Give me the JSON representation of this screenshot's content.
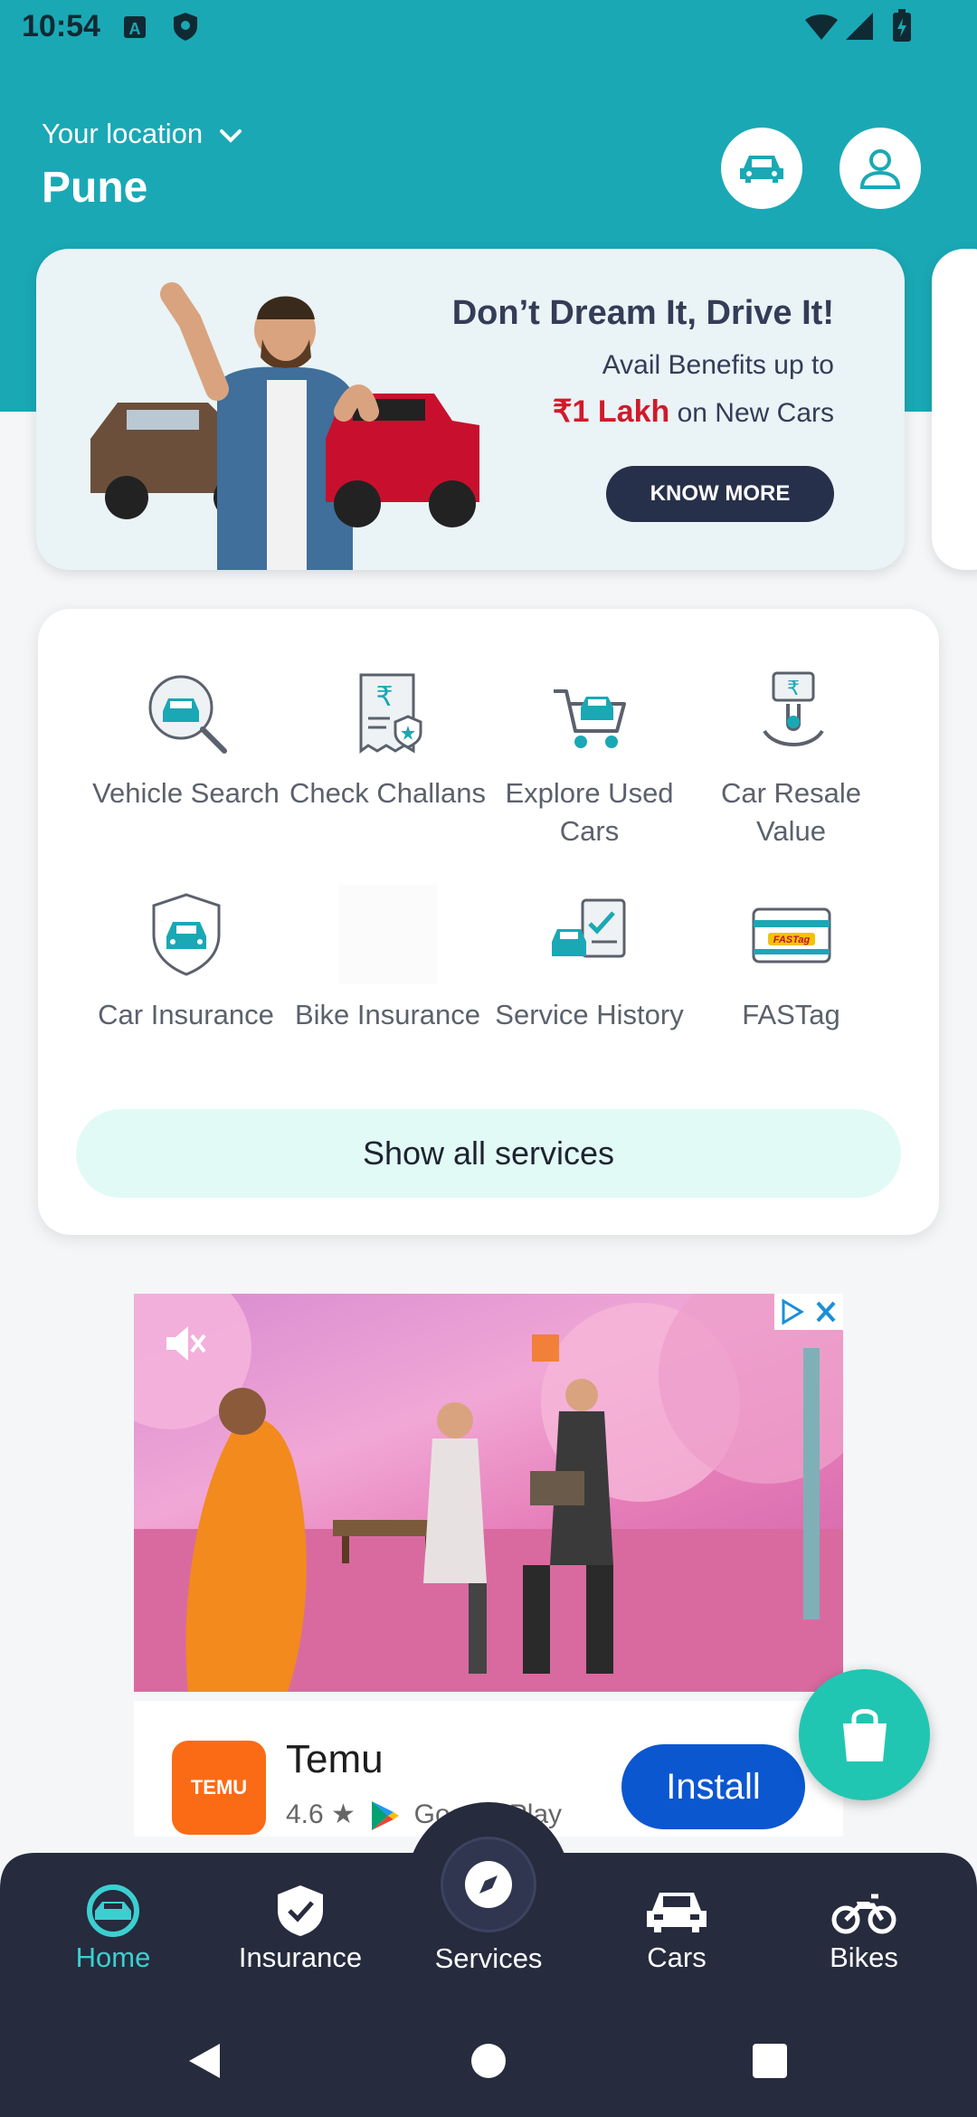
{
  "status_bar": {
    "time": "10:54"
  },
  "header": {
    "location_label": "Your location",
    "city": "Pune"
  },
  "banner": {
    "headline": "Don’t Dream It, Drive It!",
    "line1": "Avail Benefits up to",
    "highlight": "₹1 Lakh",
    "line2_suffix": " on New Cars",
    "cta": "KNOW MORE"
  },
  "services": {
    "items": [
      {
        "label": "Vehicle Search",
        "icon": "vehicle-search-icon"
      },
      {
        "label": "Check Challans",
        "icon": "challan-icon"
      },
      {
        "label": "Explore Used Cars",
        "icon": "used-cars-icon"
      },
      {
        "label": "Car Resale Value",
        "icon": "resale-value-icon"
      },
      {
        "label": "Car Insurance",
        "icon": "car-insurance-icon"
      },
      {
        "label": "Bike Insurance",
        "icon": "bike-insurance-icon"
      },
      {
        "label": "Service History",
        "icon": "service-history-icon"
      },
      {
        "label": "FASTag",
        "icon": "fastag-icon"
      }
    ],
    "show_all": "Show all services"
  },
  "ad": {
    "app_name": "Temu",
    "logo_text": "TEMU",
    "rating": "4.6 ★",
    "store": "Google Play",
    "install": "Install"
  },
  "bottom_nav": {
    "items": [
      {
        "label": "Home",
        "icon": "home-steering-icon",
        "active": true
      },
      {
        "label": "Insurance",
        "icon": "shield-check-icon",
        "active": false
      },
      {
        "label": "Services",
        "icon": "compass-icon",
        "active": false
      },
      {
        "label": "Cars",
        "icon": "car-icon",
        "active": false
      },
      {
        "label": "Bikes",
        "icon": "bike-icon",
        "active": false
      }
    ]
  },
  "colors": {
    "accent": "#1aa8b5",
    "active_nav": "#3ccfd0",
    "nav_bg": "#262b3d",
    "install": "#0b57d0",
    "fab": "#20c6b2"
  }
}
